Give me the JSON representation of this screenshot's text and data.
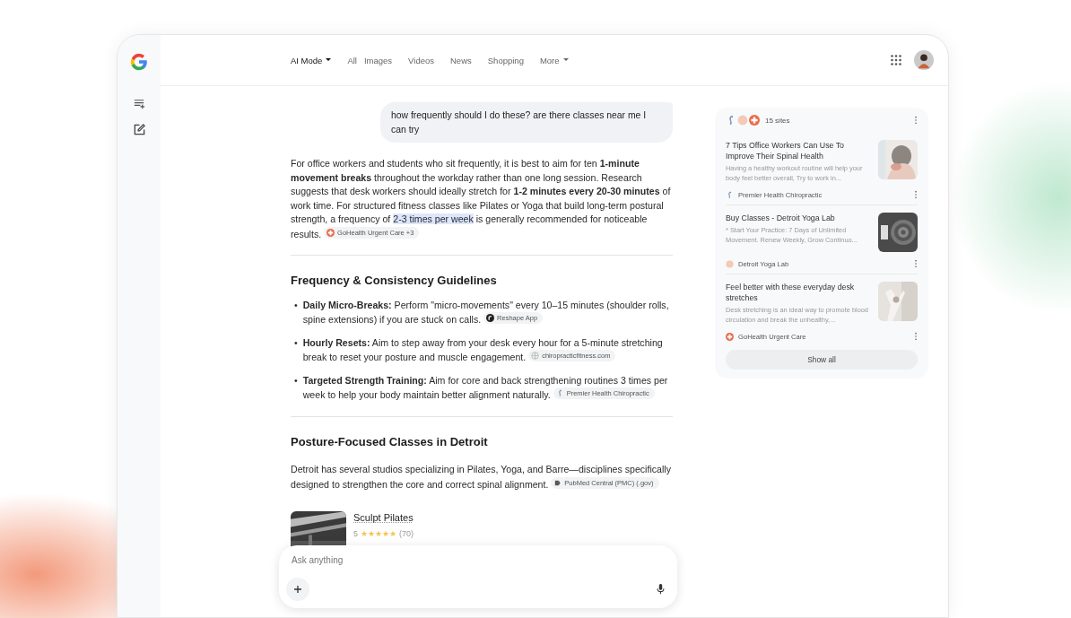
{
  "nav": {
    "tabs": [
      {
        "label": "AI Mode",
        "selected": true,
        "dropdown": true
      },
      {
        "label": "All",
        "selected": false,
        "dropdown": false
      },
      {
        "label": "Images",
        "selected": false,
        "dropdown": false
      },
      {
        "label": "Videos",
        "selected": false,
        "dropdown": false
      },
      {
        "label": "News",
        "selected": false,
        "dropdown": false
      },
      {
        "label": "Shopping",
        "selected": false,
        "dropdown": false
      },
      {
        "label": "More",
        "selected": false,
        "dropdown": true
      }
    ]
  },
  "query": "how frequently should I do these? are there classes near me I can try",
  "answer": {
    "segments": [
      {
        "text": "For office workers and students who sit frequently, it is best to aim for ten **1-minute movement breaks** throughout the workday rather than one long session. Research suggests that desk workers should ideally stretch for **1-2 minutes every 20-30 minutes** of work time. For structured fitness classes like Pilates or Yoga that build long-term postural strength, a frequency of ",
        "highlight": false
      },
      {
        "text": "2-3 times per week",
        "highlight": true
      },
      {
        "text": " is generally recommended for noticeable results.",
        "highlight": false
      }
    ],
    "citation": {
      "label": "GoHealth Urgent Care +3",
      "kind": "cross"
    }
  },
  "sections": [
    {
      "heading": "Frequency & Consistency Guidelines",
      "kind": "list",
      "items": [
        {
          "marker": "•",
          "term": "Daily Micro-Breaks:",
          "text": "Perform \"micro-movements\" every 10–15 minutes (shoulder rolls, spine extensions) if you are stuck on calls.",
          "citation": {
            "label": "Reshape App",
            "kind": "reshape"
          }
        },
        {
          "marker": "•",
          "term": "Hourly Resets:",
          "text": "Aim to step away from your desk every hour for a 5-minute stretching break to reset your posture and muscle engagement.",
          "citation": {
            "label": "chiropracticfitness.com",
            "kind": "globe"
          }
        },
        {
          "marker": "•",
          "term": "Targeted Strength Training:",
          "text": "Aim for core and back strengthening routines 3 times per week to help your body maintain better alignment naturally.",
          "citation": {
            "label": "Premier Health Chiropractic",
            "kind": "spine"
          }
        }
      ]
    },
    {
      "heading": "Posture-Focused Classes in Detroit",
      "kind": "paragraph",
      "text": "Detroit has several studios specializing in Pilates, Yoga, and Barre—disciplines specifically designed to strengthen the core and correct spinal alignment.",
      "citation": {
        "label": "PubMed Central (PMC) (.gov)",
        "kind": "doc"
      },
      "places": [
        {
          "name": "Sculpt Pilates",
          "rating": "5",
          "stars": 5,
          "count": "(70)"
        }
      ]
    }
  ],
  "sources": {
    "count": "15 sites",
    "items": [
      {
        "title": "7 Tips Office Workers Can Use To Improve Their Spinal Health",
        "snippet": "Having a healthy workout routine will help your body feel better overall, Try to work in...",
        "source": "Premier Health Chiropractic",
        "kind": "spine"
      },
      {
        "title": "Buy Classes - Detroit Yoga Lab",
        "snippet": "* Start Your Practice: 7 Days of Unlimited Movement. Renew Weekly, Grow Continuo...",
        "source": "Detroit Yoga Lab",
        "kind": "dot"
      },
      {
        "title": "Feel better with these everyday desk stretches",
        "snippet": "Desk stretching is an ideal way to promote blood circulation and break the unhealthy,...",
        "source": "GoHealth Urgent Care",
        "kind": "cross"
      }
    ],
    "show_all": "Show all"
  },
  "composer": {
    "placeholder": "Ask anything"
  }
}
